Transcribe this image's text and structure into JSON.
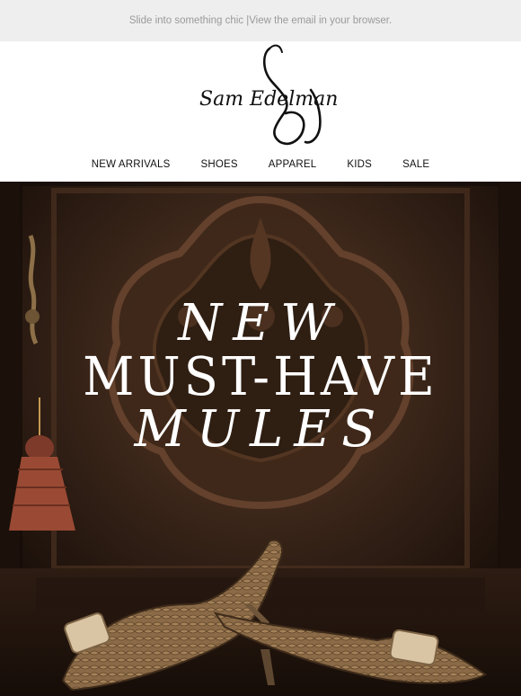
{
  "preheader": {
    "text": "Slide into something chic | ",
    "link": "View the email in your browser."
  },
  "brand": {
    "logo_text": "Sam Edelman"
  },
  "nav": {
    "items": [
      "NEW ARRIVALS",
      "SHOES",
      "APPAREL",
      "KIDS",
      "SALE"
    ]
  },
  "hero": {
    "line1": "NEW",
    "line2": "MUST-HAVE",
    "line3": "MULES"
  },
  "colors": {
    "preheader_bg": "#eeeeee",
    "hero_wood": "#2a1a11",
    "headline": "#ffffff"
  }
}
